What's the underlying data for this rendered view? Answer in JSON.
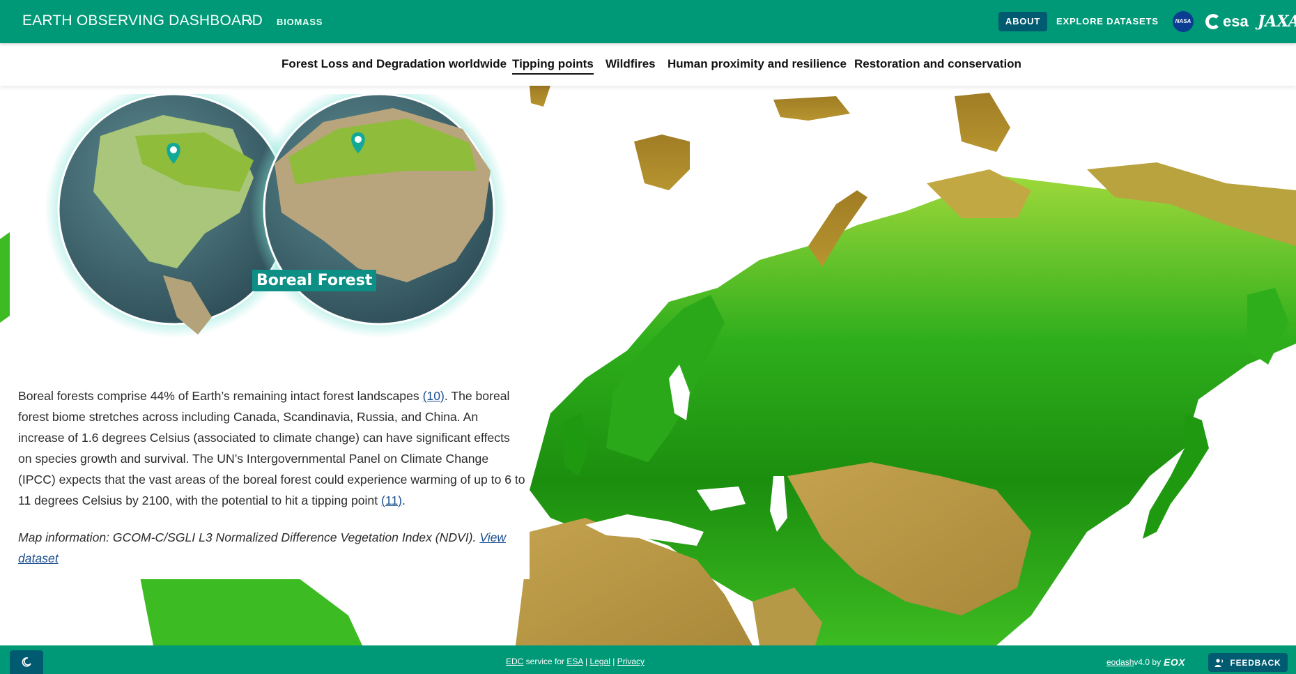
{
  "header": {
    "app_title": "EARTH OBSERVING DASHBOARD",
    "breadcrumb_separator": "›",
    "breadcrumb": "BIOMASS",
    "about_label": "ABOUT",
    "explore_label": "EXPLORE DATASETS",
    "partner_logos": [
      {
        "name": "NASA",
        "text": "NASA"
      },
      {
        "name": "esa",
        "text": "esa"
      },
      {
        "name": "JAXA",
        "text": "JAXA"
      }
    ]
  },
  "tabs": [
    {
      "label": "Forest Loss and Degradation worldwide",
      "active": false
    },
    {
      "label": "Tipping points",
      "active": true
    },
    {
      "label": "Wildfires",
      "active": false
    },
    {
      "label": "Human proximity and resilience",
      "active": false
    },
    {
      "label": "Restoration and conservation",
      "active": false
    }
  ],
  "story": {
    "globe_caption": "Boreal Forest",
    "paragraph_part1": "Boreal forests comprise 44% of Earth’s remaining intact forest landscapes ",
    "ref1": "(10)",
    "paragraph_part2": ". The boreal forest biome stretches across including Canada, Scandinavia, Russia, and China. An increase of 1.6 degrees Celsius (associated to climate change) can have significant effects on species growth and survival. The UN’s Intergovernmental Panel on Climate Change (IPCC) expects that the vast areas of the boreal forest could experience warming of up to 6 to 11 degrees Celsius by 2100, with the potential to hit a tipping point ",
    "ref2": "(11)",
    "paragraph_end": ".",
    "map_info": "Map information: GCOM-C/SGLI L3 Normalized Difference Vegetation Index (NDVI). ",
    "view_dataset": "View dataset"
  },
  "footer": {
    "edc": "EDC",
    "service_for": " service for ",
    "esa": "ESA",
    "sep1": "  | ",
    "legal": "Legal",
    "sep2": " | ",
    "privacy": "Privacy",
    "eodash": "eodash",
    "version": " v4.0 by ",
    "eox": "EOX",
    "feedback_label": "FEEDBACK",
    "theme_icon": "moon-icon"
  },
  "colors": {
    "brand_green": "#009977",
    "button_dark": "#005a70",
    "ndvi_high": "#1f9a10",
    "ndvi_mid": "#8fd632",
    "ndvi_low": "#b09040",
    "globe_glow": "#7fe3d6"
  }
}
